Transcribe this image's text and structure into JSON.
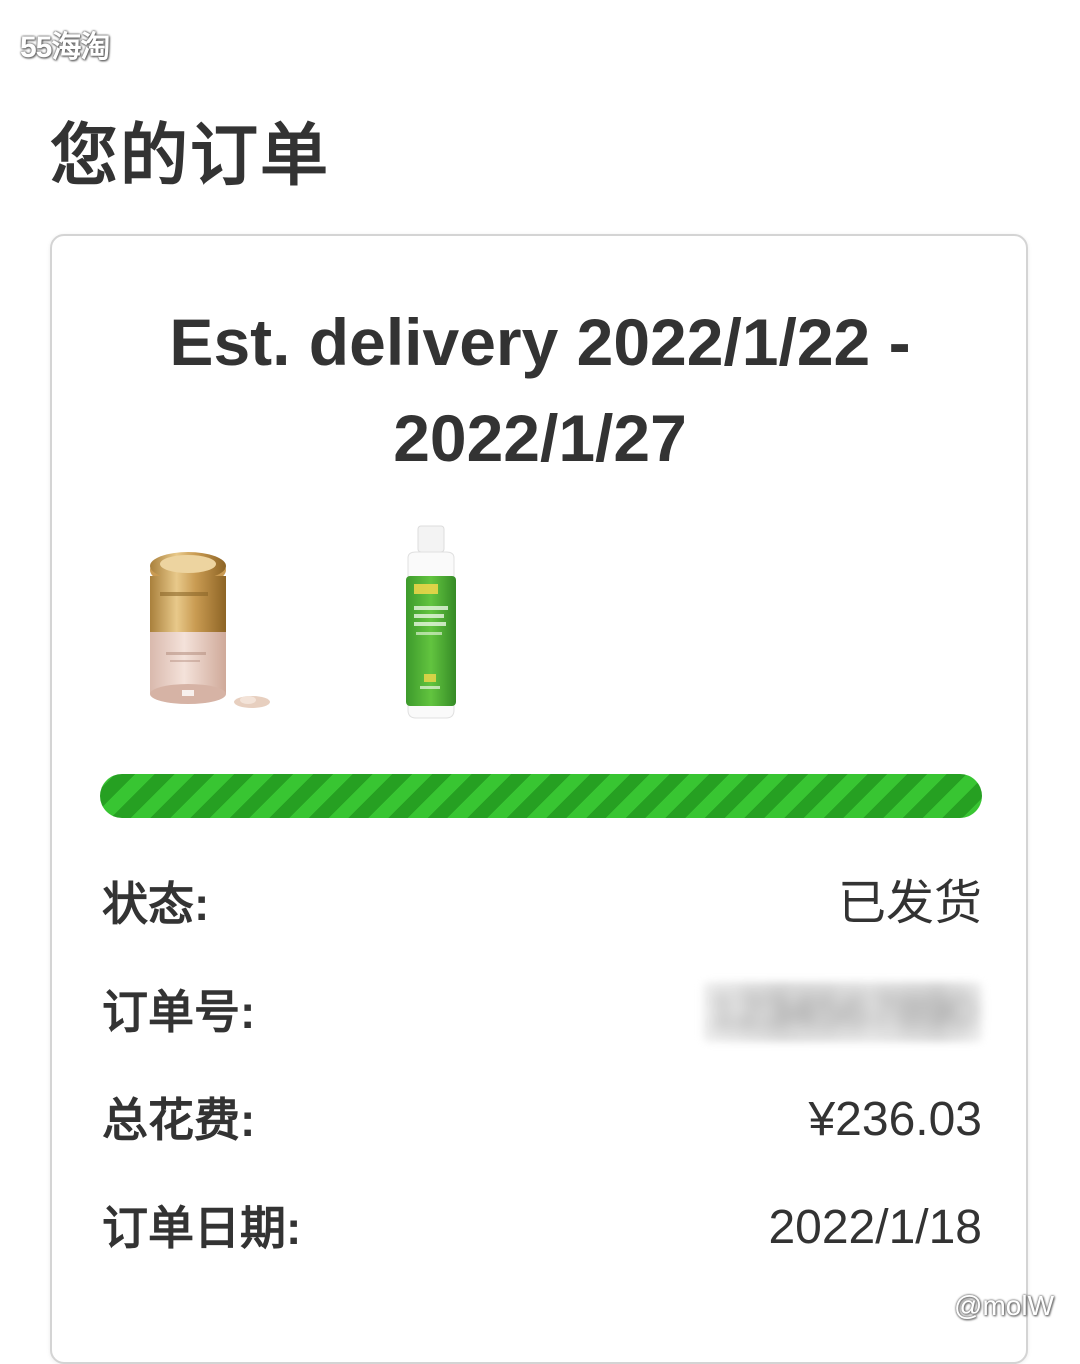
{
  "watermark_top": "55海淘",
  "page_title": "您的订单",
  "order": {
    "est_delivery_line1": "Est. delivery 2022/1/22 -",
    "est_delivery_line2": "2022/1/27",
    "progress_percent": 100,
    "progress_color": "#2fb52a",
    "products": [
      {
        "name": "foundation-jar-image"
      },
      {
        "name": "lotion-bottle-image"
      }
    ],
    "rows": [
      {
        "label": "状态:",
        "value": "已发货"
      },
      {
        "label": "订单号:",
        "value": "1234567890"
      },
      {
        "label": "总花费:",
        "value": "¥236.03"
      },
      {
        "label": "订单日期:",
        "value": "2022/1/18"
      }
    ]
  },
  "watermark_bottom": "@molW"
}
